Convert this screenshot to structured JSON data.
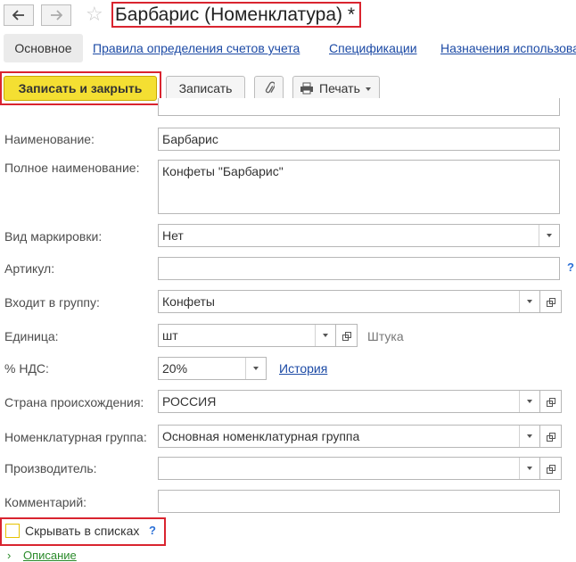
{
  "window": {
    "title": "Барбарис (Номенклатура) *"
  },
  "tabs": [
    {
      "label": "Основное"
    },
    {
      "label": "Правила определения счетов учета"
    },
    {
      "label": "Спецификации"
    },
    {
      "label": "Назначения использования"
    }
  ],
  "toolbar": {
    "save_close_label": "Записать и закрыть",
    "save_label": "Записать",
    "print_label": "Печать"
  },
  "form": {
    "name": {
      "label": "Наименование:",
      "value": "Барбарис"
    },
    "full_name": {
      "label": "Полное наименование:",
      "value": "Конфеты \"Барбарис\""
    },
    "marking": {
      "label": "Вид маркировки:",
      "value": "Нет"
    },
    "article": {
      "label": "Артикул:",
      "value": ""
    },
    "group": {
      "label": "Входит в группу:",
      "value": "Конфеты"
    },
    "unit": {
      "label": "Единица:",
      "value": "шт",
      "full": "Штука"
    },
    "vat": {
      "label": "% НДС:",
      "value": "20%",
      "history_link": "История"
    },
    "country": {
      "label": "Страна происхождения:",
      "value": "РОССИЯ"
    },
    "nom_group": {
      "label": "Номенклатурная группа:",
      "value": "Основная номенклатурная группа"
    },
    "manufacturer": {
      "label": "Производитель:",
      "value": ""
    },
    "comment": {
      "label": "Комментарий:",
      "value": ""
    },
    "hide_in_lists": {
      "label": "Скрывать в списках",
      "checked": false
    },
    "help_mark": "?",
    "description_group": "Описание"
  },
  "colors": {
    "accent_highlight": "#d9242f",
    "primary_button": "#f4df32",
    "link": "#1c4aa5"
  }
}
